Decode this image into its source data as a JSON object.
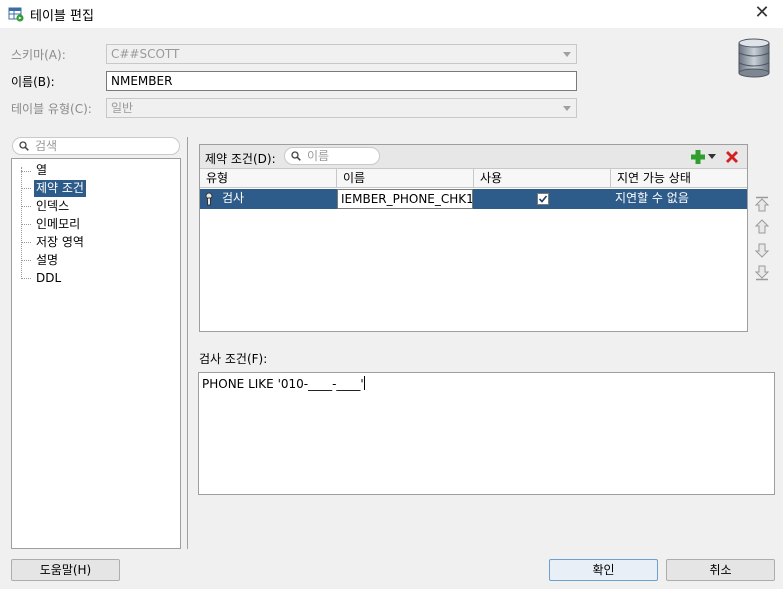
{
  "window": {
    "title": "테이블 편집",
    "close_glyph": "✕"
  },
  "form": {
    "schema_label": "스키마(A):",
    "schema_value": "C##SCOTT",
    "name_label": "이름(B):",
    "name_value": "NMEMBER",
    "table_type_label": "테이블 유형(C):",
    "table_type_value": "일반"
  },
  "left_panel": {
    "search_placeholder": "검색",
    "tree_items": [
      "열",
      "제약 조건",
      "인덱스",
      "인메모리",
      "저장 영역",
      "설명",
      "DDL"
    ],
    "selected_index": 1
  },
  "constraints": {
    "label": "제약 조건(D):",
    "search_placeholder": "이름",
    "columns": [
      "유형",
      "이름",
      "사용",
      "지연 가능 상태"
    ],
    "rows": [
      {
        "type": "검사",
        "name": "IEMBER_PHONE_CHK1",
        "enabled": true,
        "deferrable": "지연할 수 없음"
      }
    ]
  },
  "check_condition": {
    "label": "검사 조건(F):",
    "value": "PHONE LIKE '010-____-____'"
  },
  "buttons": {
    "help": "도움말(H)",
    "ok": "확인",
    "cancel": "취소"
  },
  "icons": {
    "accent_add": "#2f9e2f",
    "accent_delete": "#d42020",
    "selection": "#2e5c8a"
  }
}
